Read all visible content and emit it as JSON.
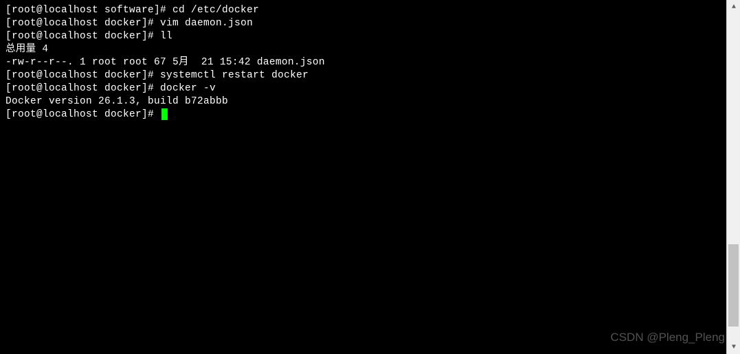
{
  "terminal": {
    "lines": [
      {
        "prompt": "[root@localhost software]# ",
        "command": "cd /etc/docker"
      },
      {
        "prompt": "[root@localhost docker]# ",
        "command": "vim daemon.json"
      },
      {
        "prompt": "[root@localhost docker]# ",
        "command": "ll"
      },
      {
        "output": "总用量 4"
      },
      {
        "output": "-rw-r--r--. 1 root root 67 5月  21 15:42 daemon.json"
      },
      {
        "prompt": "[root@localhost docker]# ",
        "command": "systemctl restart docker"
      },
      {
        "prompt": "[root@localhost docker]# ",
        "command": "docker -v"
      },
      {
        "output": "Docker version 26.1.3, build b72abbb"
      },
      {
        "prompt": "[root@localhost docker]# ",
        "command": "",
        "cursor": true
      }
    ]
  },
  "scrollbar": {
    "arrow_up": "▲",
    "arrow_down": "▼"
  },
  "watermark": "CSDN @Pleng_Pleng"
}
